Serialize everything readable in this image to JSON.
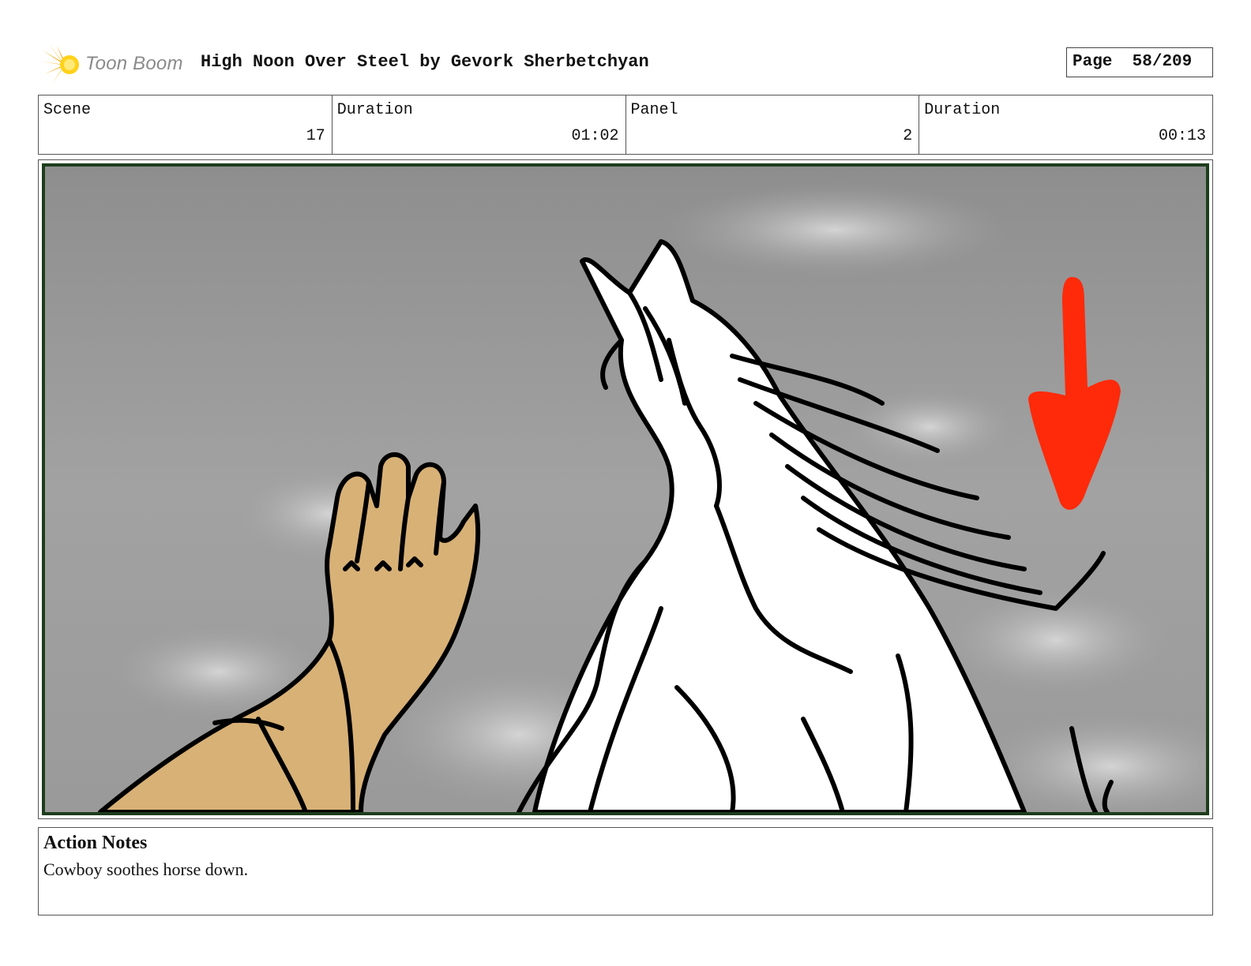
{
  "header": {
    "logo_text": "Toon Boom",
    "title": "High Noon Over Steel by Gevork Sherbetchyan",
    "page_label": "Page",
    "page_value": "58/209"
  },
  "info": {
    "scene_label": "Scene",
    "scene_value": "17",
    "scene_duration_label": "Duration",
    "scene_duration_value": "01:02",
    "panel_label": "Panel",
    "panel_value": "2",
    "panel_duration_label": "Duration",
    "panel_duration_value": "00:13"
  },
  "notes": {
    "title": "Action Notes",
    "text": "Cowboy soothes horse down."
  },
  "colors": {
    "logo_orange": "#f5a300",
    "logo_yellow": "#ffd21a",
    "panel_border": "#1d3d1d",
    "arrow_red": "#ff2a0a",
    "hand_skin": "#d8b176",
    "sky_grey": "#9a9a9a"
  },
  "icons": {
    "logo": "toon-boom-sunburst-icon"
  }
}
